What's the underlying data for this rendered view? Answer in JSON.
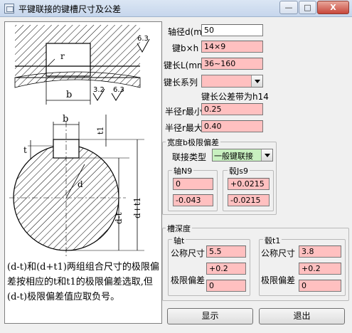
{
  "window": {
    "title": "平键联接的键槽尺寸及公差",
    "min_label": "—",
    "max_label": "□",
    "close_label": "X"
  },
  "figure": {
    "labels": {
      "r": "r",
      "b_top": "b",
      "b_mid": "b",
      "t1": "t1",
      "t": "t",
      "d": "d",
      "d_minus_t": "d-t",
      "d_plus_t1": "d+t1",
      "rough1": "6.3",
      "rough2": "3.2",
      "rough3": "6.3"
    },
    "note": "(d-t)和(d+t1)两组组合尺寸的极限偏差按相应的t和t1的极限偏差选取,但(d-t)极限偏差值应取负号。"
  },
  "form": {
    "shaft_diameter": {
      "label": "轴径d(mm)",
      "value": "50"
    },
    "key_bxh": {
      "label": "键b×h",
      "value": "14×9"
    },
    "key_length": {
      "label": "键长L(mm)",
      "value": "36~160"
    },
    "key_length_series": {
      "label": "键长系列",
      "value": ""
    },
    "key_length_tol": {
      "label": "键长公差带为h14"
    },
    "radius_min": {
      "label": "半径r最小",
      "value": "0.25"
    },
    "radius_max": {
      "label": "半径r最大",
      "value": "0.40"
    }
  },
  "width_tol": {
    "title": "宽度b极限偏差",
    "connection_type_label": "联接类型",
    "connection_type_value": "一般键联接",
    "shaft": {
      "title": "轴N9",
      "upper": "0",
      "lower": "-0.043"
    },
    "hub": {
      "title": "毂Js9",
      "upper": "+0.0215",
      "lower": "-0.0215"
    }
  },
  "depth": {
    "title": "槽深度",
    "shaft": {
      "title": "轴t",
      "nominal_label": "公称尺寸",
      "nominal": "5.5",
      "limit_label": "极限偏差",
      "upper": "+0.2",
      "lower": "0"
    },
    "hub": {
      "title": "毂t1",
      "nominal_label": "公称尺寸",
      "nominal": "3.8",
      "limit_label": "极限偏差",
      "upper": "+0.2",
      "lower": "0"
    }
  },
  "buttons": {
    "show": "显示",
    "exit": "退出"
  }
}
